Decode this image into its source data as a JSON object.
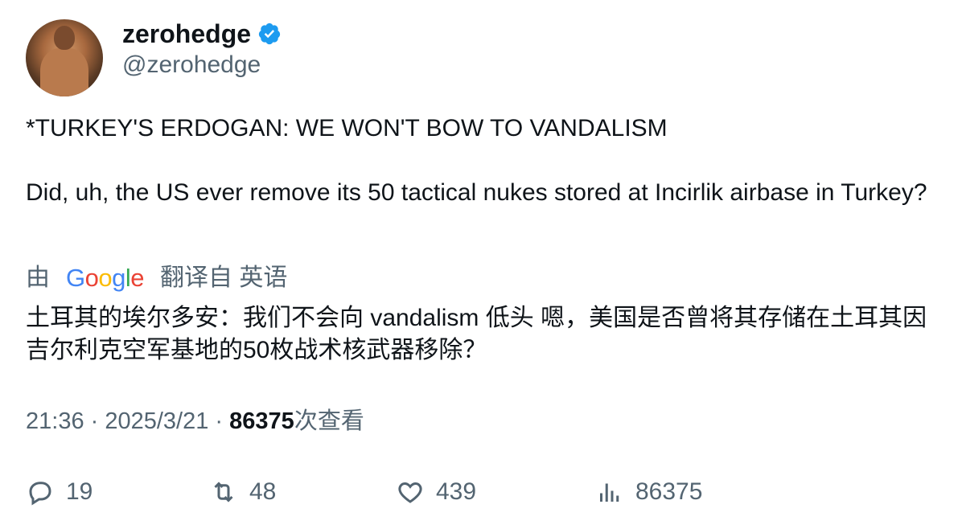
{
  "author": {
    "display_name": "zerohedge",
    "handle": "@zerohedge",
    "verified": true,
    "verified_color": "#1d9bf0"
  },
  "tweet": {
    "line1": "*TURKEY'S ERDOGAN: WE WON'T BOW TO VANDALISM",
    "line2": "Did, uh, the US ever remove its 50 tactical nukes stored at Incirlik airbase in Turkey?"
  },
  "translation": {
    "prefix": "由",
    "provider": "Google",
    "suffix": "翻译自 英语",
    "text": "土耳其的埃尔多安：我们不会向 vandalism 低头 嗯，美国是否曾将其存储在土耳其因吉尔利克空军基地的50枚战术核武器移除？"
  },
  "meta": {
    "time": "21:36",
    "date": "2025/3/21",
    "views_count": "86375",
    "views_label": "次查看"
  },
  "actions": {
    "replies": "19",
    "retweets": "48",
    "likes": "439",
    "views": "86375"
  }
}
